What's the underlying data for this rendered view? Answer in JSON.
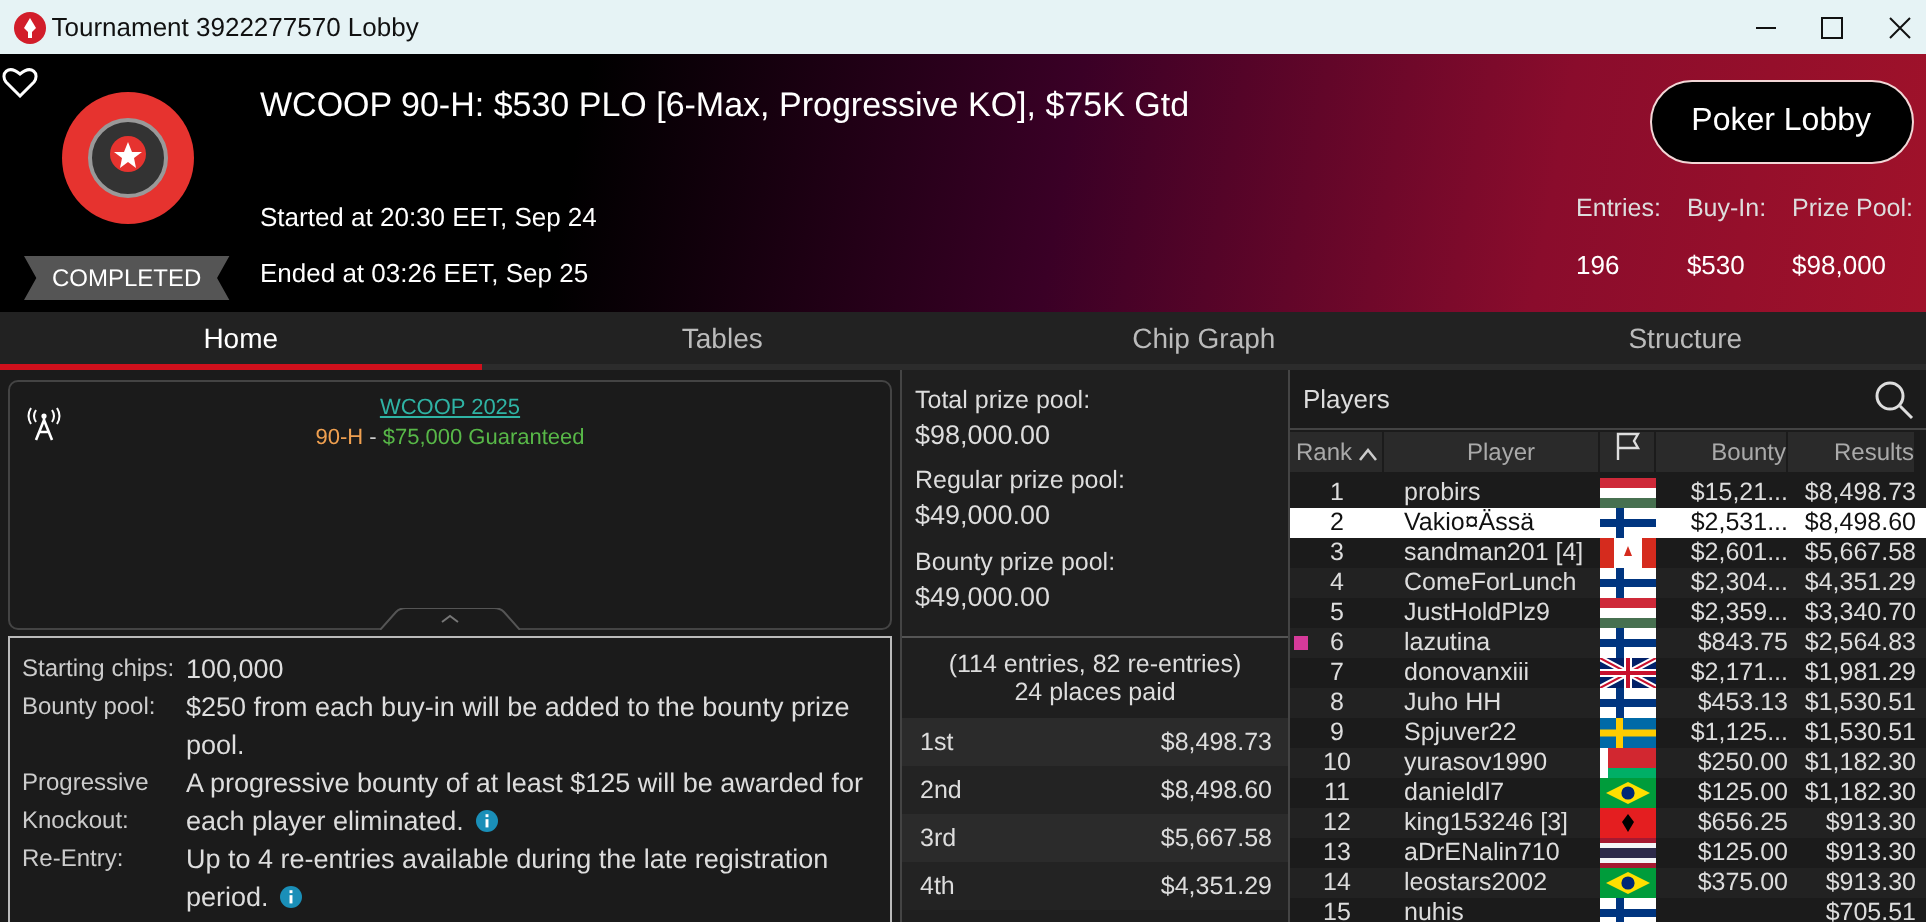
{
  "window": {
    "title": "Tournament 3922277570 Lobby"
  },
  "header": {
    "status": "COMPLETED",
    "title": "WCOOP 90-H: $530 PLO [6-Max, Progressive KO], $75K Gtd",
    "started": "Started at 20:30 EET, Sep 24",
    "ended": "Ended at 03:26 EET, Sep 25",
    "button": "Poker Lobby",
    "stats": [
      {
        "label": "Entries:",
        "value": "196"
      },
      {
        "label": "Buy-In:",
        "value": "$530"
      },
      {
        "label": "Prize Pool:",
        "value": "$98,000"
      }
    ]
  },
  "tabs": [
    {
      "label": "Home",
      "selected": true
    },
    {
      "label": "Tables",
      "selected": false
    },
    {
      "label": "Chip Graph",
      "selected": false
    },
    {
      "label": "Structure",
      "selected": false
    }
  ],
  "series": {
    "link": "WCOOP 2025",
    "code": "90-H",
    "separator": " - ",
    "guarantee": "$75,000 Guaranteed"
  },
  "details": [
    {
      "label": "Starting chips:",
      "value": "100,000",
      "info": false
    },
    {
      "label": "Bounty pool:",
      "value": "$250 from each buy-in will be added to the bounty prize pool.",
      "info": false
    },
    {
      "label": "Progressive Knockout:",
      "value": "A progressive bounty of at least $125 will be awarded for each player eliminated.",
      "info": true
    },
    {
      "label": "Re-Entry:",
      "value": "Up to 4 re-entries available during the late registration period.",
      "info": true
    }
  ],
  "prize_pools": [
    {
      "label": "Total prize pool:",
      "value": "$98,000.00"
    },
    {
      "label": "Regular prize pool:",
      "value": "$49,000.00"
    },
    {
      "label": "Bounty prize pool:",
      "value": "$49,000.00"
    }
  ],
  "entries_note": "(114 entries, 82 re-entries)",
  "places_paid": "24 places paid",
  "payouts": [
    {
      "place": "1st",
      "amount": "$8,498.73"
    },
    {
      "place": "2nd",
      "amount": "$8,498.60"
    },
    {
      "place": "3rd",
      "amount": "$5,667.58"
    },
    {
      "place": "4th",
      "amount": "$4,351.29"
    }
  ],
  "players": {
    "title": "Players",
    "columns": [
      "Rank",
      "Player",
      "Bounty",
      "Results"
    ],
    "rows": [
      {
        "rank": "1",
        "player": "probirs",
        "kind": "hu",
        "bounty": "$15,21...",
        "results": "$8,498.73",
        "selected": false,
        "marked": false
      },
      {
        "rank": "2",
        "player": "Vakio¤Ässä",
        "kind": "fi",
        "bounty": "$2,531...",
        "results": "$8,498.60",
        "selected": true,
        "marked": false
      },
      {
        "rank": "3",
        "player": "sandman201 [4]",
        "kind": "ca",
        "bounty": "$2,601...",
        "results": "$5,667.58",
        "selected": false,
        "marked": false
      },
      {
        "rank": "4",
        "player": "ComeForLunch",
        "kind": "fi",
        "bounty": "$2,304...",
        "results": "$4,351.29",
        "selected": false,
        "marked": false
      },
      {
        "rank": "5",
        "player": "JustHoldPlz9",
        "kind": "hu",
        "bounty": "$2,359...",
        "results": "$3,340.70",
        "selected": false,
        "marked": false
      },
      {
        "rank": "6",
        "player": "lazutina",
        "kind": "fi",
        "bounty": "$843.75",
        "results": "$2,564.83",
        "selected": false,
        "marked": true
      },
      {
        "rank": "7",
        "player": "donovanxiii",
        "kind": "gb",
        "bounty": "$2,171...",
        "results": "$1,981.29",
        "selected": false,
        "marked": false
      },
      {
        "rank": "8",
        "player": "Juho HH",
        "kind": "fi",
        "bounty": "$453.13",
        "results": "$1,530.51",
        "selected": false,
        "marked": false
      },
      {
        "rank": "9",
        "player": "Spjuver22",
        "kind": "se",
        "bounty": "$1,125...",
        "results": "$1,530.51",
        "selected": false,
        "marked": false
      },
      {
        "rank": "10",
        "player": "yurasov1990",
        "kind": "by",
        "bounty": "$250.00",
        "results": "$1,182.30",
        "selected": false,
        "marked": false
      },
      {
        "rank": "11",
        "player": "danieldl7",
        "kind": "br",
        "bounty": "$125.00",
        "results": "$1,182.30",
        "selected": false,
        "marked": false
      },
      {
        "rank": "12",
        "player": "king153246 [3]",
        "kind": "al",
        "bounty": "$656.25",
        "results": "$913.30",
        "selected": false,
        "marked": false
      },
      {
        "rank": "13",
        "player": "aDrENalin710",
        "kind": "th",
        "bounty": "$125.00",
        "results": "$913.30",
        "selected": false,
        "marked": false
      },
      {
        "rank": "14",
        "player": "leostars2002",
        "kind": "br",
        "bounty": "$375.00",
        "results": "$913.30",
        "selected": false,
        "marked": false
      },
      {
        "rank": "15",
        "player": "nuhis",
        "kind": "fi",
        "bounty": "",
        "results": "$705.51",
        "selected": false,
        "marked": false
      }
    ]
  }
}
